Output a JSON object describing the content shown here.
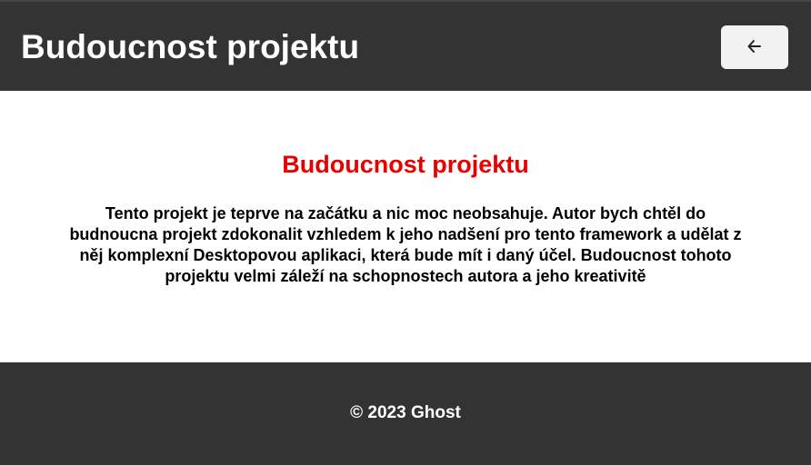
{
  "header": {
    "title": "Budoucnost projektu",
    "back_icon": "arrow-left-icon"
  },
  "main": {
    "heading": "Budoucnost projektu",
    "text": "Tento projekt je teprve na začátku a nic moc neobsahuje. Autor bych chtěl do budnoucna projekt zdokonalit vzhledem k jeho nadšení pro tento framework a udělat z něj komplexní Desktopovou aplikaci, která bude mít i daný účel. Budoucnost tohoto projektu velmi záleží na schopnostech autora a jeho kreativitě"
  },
  "footer": {
    "copyright": "© 2023 Ghost"
  },
  "colors": {
    "header_bg": "#333333",
    "heading_red": "#e60000",
    "button_bg": "#f2f2f2"
  }
}
